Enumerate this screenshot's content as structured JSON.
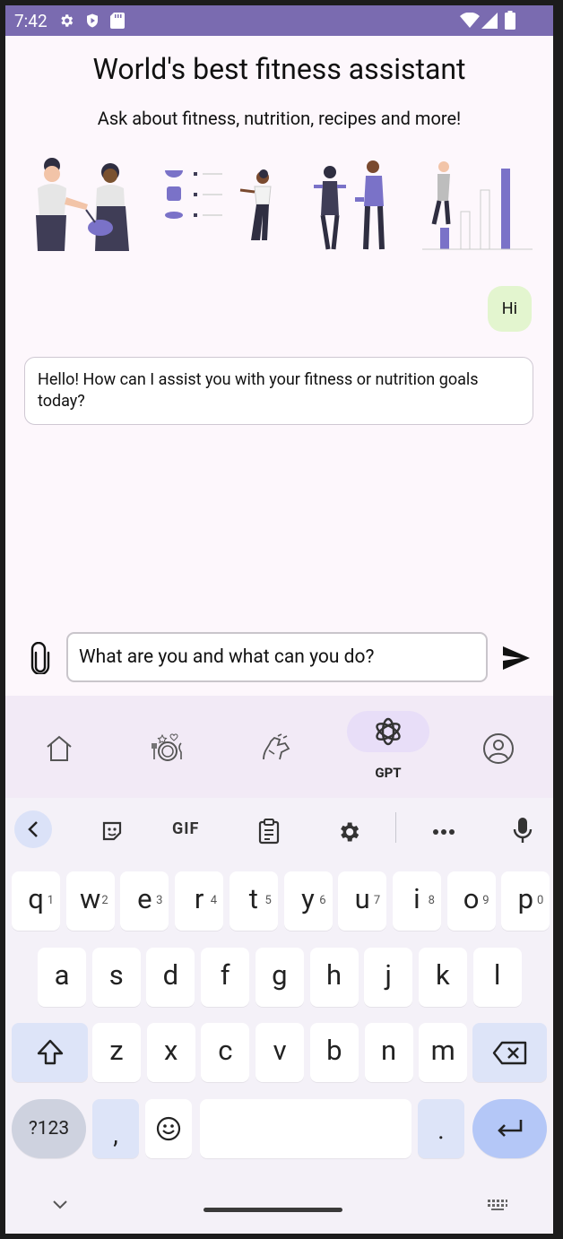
{
  "status_bar": {
    "time": "7:42"
  },
  "header": {
    "title": "World's best fitness assistant",
    "subtitle": "Ask about fitness, nutrition, recipes and more!"
  },
  "chat": {
    "messages": [
      {
        "role": "user",
        "text": "Hi"
      },
      {
        "role": "assistant",
        "text": "Hello! How can I assist you with your fitness or nutrition goals today?"
      }
    ]
  },
  "composer": {
    "value": "What are you and what can you do?",
    "attach_icon": "paperclip-icon",
    "send_icon": "send-icon"
  },
  "bottom_nav": {
    "items": [
      {
        "icon": "home-icon",
        "label": ""
      },
      {
        "icon": "meal-icon",
        "label": ""
      },
      {
        "icon": "workout-icon",
        "label": ""
      },
      {
        "icon": "openai-icon",
        "label": "GPT",
        "active": true
      },
      {
        "icon": "profile-icon",
        "label": ""
      }
    ]
  },
  "keyboard": {
    "toolbar": {
      "gif_label": "GIF"
    },
    "row1": [
      {
        "k": "q",
        "h": "1"
      },
      {
        "k": "w",
        "h": "2"
      },
      {
        "k": "e",
        "h": "3"
      },
      {
        "k": "r",
        "h": "4"
      },
      {
        "k": "t",
        "h": "5"
      },
      {
        "k": "y",
        "h": "6"
      },
      {
        "k": "u",
        "h": "7"
      },
      {
        "k": "i",
        "h": "8"
      },
      {
        "k": "o",
        "h": "9"
      },
      {
        "k": "p",
        "h": "0"
      }
    ],
    "row2": [
      "a",
      "s",
      "d",
      "f",
      "g",
      "h",
      "j",
      "k",
      "l"
    ],
    "row3": [
      "z",
      "x",
      "c",
      "v",
      "b",
      "n",
      "m"
    ],
    "symbols_label": "?123",
    "comma": ",",
    "period": "."
  },
  "colors": {
    "status_bar": "#7a6bb0",
    "accent": "#7a72c8",
    "user_bubble": "#e3f5cf",
    "nav_active_pill": "#e8def8"
  }
}
